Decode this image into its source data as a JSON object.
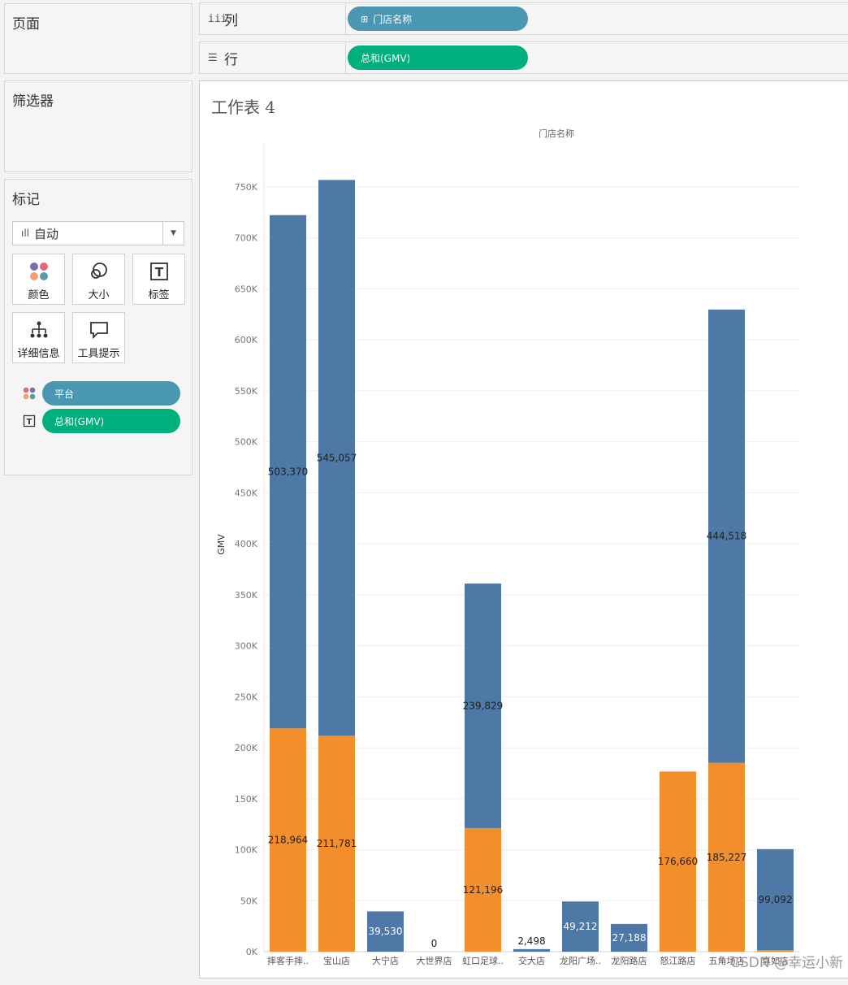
{
  "left": {
    "pages_title": "页面",
    "filters_title": "筛选器",
    "marks_title": "标记",
    "mark_type": "自动",
    "mark_buttons": [
      "颜色",
      "大小",
      "标签",
      "详细信息",
      "工具提示"
    ],
    "mark_fields": [
      {
        "field": "平台",
        "type": "color"
      },
      {
        "field": "总和(GMV)",
        "type": "label"
      }
    ]
  },
  "shelves": {
    "columns_label": "列",
    "columns_pill": "门店名称",
    "rows_label": "行",
    "rows_pill": "总和(GMV)"
  },
  "sheet": {
    "title": "工作表 4",
    "watermark": "CSDN @幸运小新"
  },
  "colors": {
    "blue": "#4e79a7",
    "orange": "#f28e2b",
    "pill_blue": "#4a97b4",
    "pill_green": "#00b07c"
  },
  "chart_data": {
    "type": "bar",
    "stacked": true,
    "title": "门店名称",
    "xlabel": "",
    "ylabel": "GMV",
    "ylim": [
      0,
      770000
    ],
    "yticks": [
      0,
      50000,
      100000,
      150000,
      200000,
      250000,
      300000,
      350000,
      400000,
      450000,
      500000,
      550000,
      600000,
      650000,
      700000,
      750000
    ],
    "ytick_labels": [
      "0K",
      "50K",
      "100K",
      "150K",
      "200K",
      "250K",
      "300K",
      "350K",
      "400K",
      "450K",
      "500K",
      "550K",
      "600K",
      "650K",
      "700K",
      "750K"
    ],
    "categories": [
      "摔客手摔..",
      "宝山店",
      "大宁店",
      "大世界店",
      "虹口足球..",
      "交大店",
      "龙阳广场..",
      "龙阳路店",
      "怒江路店",
      "五角场店",
      "真如店"
    ],
    "series": [
      {
        "color": "#f28e2b",
        "values": [
          218964,
          211781,
          0,
          0,
          121196,
          0,
          0,
          0,
          176660,
          185227,
          1500
        ],
        "labels": [
          "218,964",
          "211,781",
          "",
          "",
          "121,196",
          "",
          "",
          "",
          "176,660",
          "185,227",
          ""
        ]
      },
      {
        "color": "#4e79a7",
        "values": [
          503370,
          545057,
          39530,
          0,
          239829,
          2498,
          49212,
          27188,
          0,
          444518,
          99092
        ],
        "labels": [
          "503,370",
          "545,057",
          "39,530",
          "0",
          "239,829",
          "2,498",
          "49,212",
          "27,188",
          "",
          "444,518",
          "99,092"
        ]
      }
    ]
  }
}
